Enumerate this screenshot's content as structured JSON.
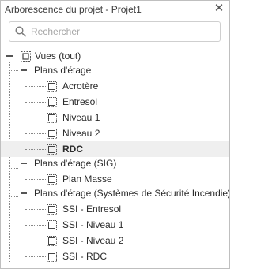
{
  "panel": {
    "title": "Arborescence du projet - Projet1",
    "close_glyph": "✕"
  },
  "search": {
    "placeholder": "Rechercher",
    "value": ""
  },
  "tree": {
    "root_label": "Vues (tout)",
    "groups": [
      {
        "label": "Plans d'étage",
        "items": [
          "Acrotère",
          "Entresol",
          "Niveau 1",
          "Niveau 2",
          "RDC"
        ]
      },
      {
        "label": "Plans d'étage (SIG)",
        "items": [
          "Plan Masse"
        ]
      },
      {
        "label": "Plans d'étage (Systèmes de Sécurité Incendie)",
        "items": [
          "SSI - Entresol",
          "SSI - Niveau 1",
          "SSI - Niveau 2",
          "SSI - RDC"
        ]
      }
    ],
    "selected_item": "RDC"
  }
}
